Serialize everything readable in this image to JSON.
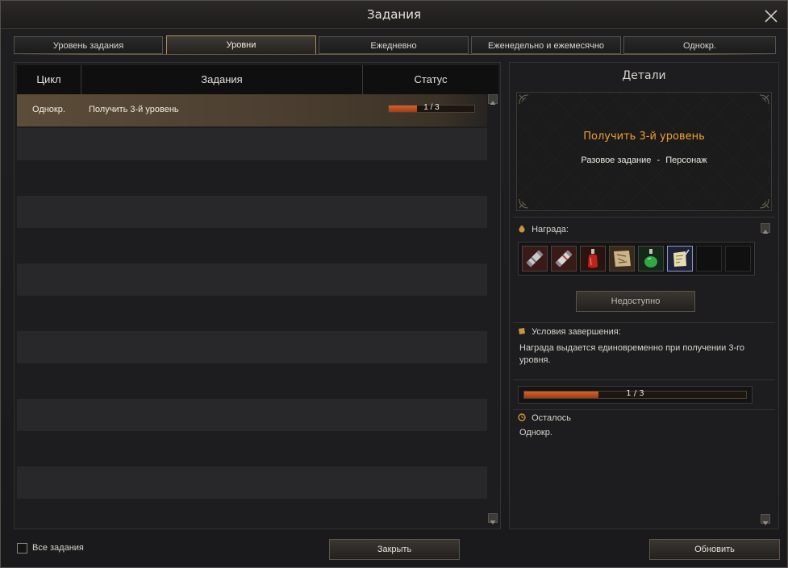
{
  "window": {
    "title": "Задания"
  },
  "tabs": [
    {
      "label": "Уровень задания"
    },
    {
      "label": "Уровни"
    },
    {
      "label": "Ежедневно"
    },
    {
      "label": "Еженедельно и ежемесячно"
    },
    {
      "label": "Однокр."
    }
  ],
  "table": {
    "headers": {
      "cycle": "Цикл",
      "tasks": "Задания",
      "status": "Статус"
    },
    "rows": [
      {
        "cycle": "Однокр.",
        "task": "Получить 3-й уровень",
        "progress_text": "1 / 3",
        "progress": 0.333
      }
    ]
  },
  "details": {
    "title": "Детали",
    "quest_name": "Получить 3-й уровень",
    "quest_type": "Разовое задание",
    "separator": "-",
    "quest_scope": "Персонаж",
    "reward_label": "Награда:",
    "reward_icons": [
      "scroll-case-icon",
      "scroll-case-icon",
      "red-potion-icon",
      "map-scroll-icon",
      "green-potion-icon",
      "parchment-quill-icon"
    ],
    "unavailable_button": "Недоступно",
    "conditions_label": "Условия завершения:",
    "conditions_text": "Награда выдается единовременно при получении 3-го уровня.",
    "progress_text": "1 / 3",
    "progress": 0.333,
    "remaining_label": "Осталось",
    "remaining_value": "Однокр."
  },
  "footer": {
    "all_tasks_label": "Все задания",
    "close_button": "Закрыть",
    "refresh_button": "Обновить"
  },
  "colors": {
    "accent_orange": "#f0a030",
    "progress_fill": "#c9542a",
    "active_tab_border": "#b48f55"
  }
}
